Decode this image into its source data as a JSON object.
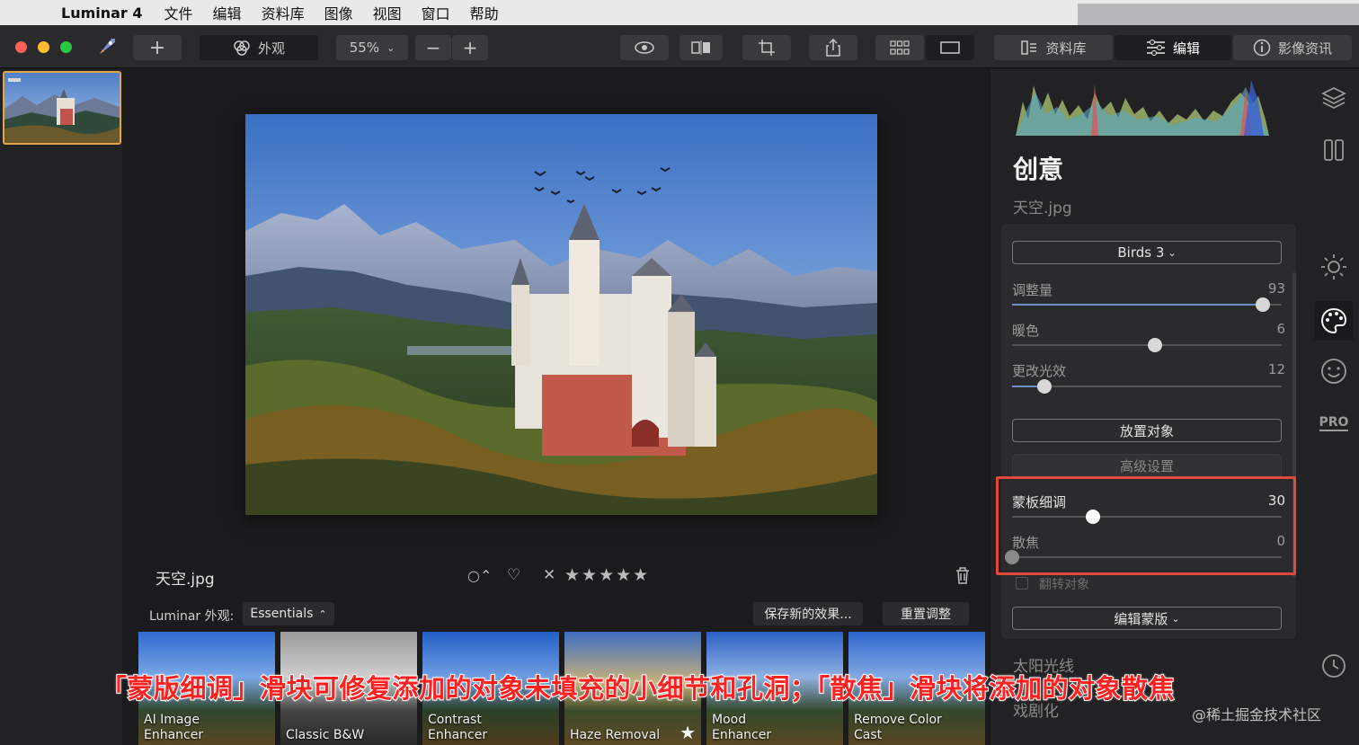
{
  "menubar": {
    "app_name": "Luminar 4",
    "items": [
      "文件",
      "编辑",
      "资料库",
      "图像",
      "视图",
      "窗口",
      "帮助"
    ]
  },
  "toolbar": {
    "looks_label": "外观",
    "zoom_value": "55%",
    "library_tab": "资料库",
    "edit_tab": "编辑",
    "info_tab": "影像资讯"
  },
  "main": {
    "filename": "天空.jpg",
    "looks": {
      "label": "Luminar 外观:",
      "collection": "Essentials",
      "save_button": "保存新的效果...",
      "reset_button": "重置调整"
    },
    "presets": [
      {
        "line1": "AI Image",
        "line2": "Enhancer"
      },
      {
        "line1": "",
        "line2": "Classic B&W"
      },
      {
        "line1": "Contrast",
        "line2": "Enhancer"
      },
      {
        "line1": "",
        "line2": "Haze Removal"
      },
      {
        "line1": "Mood",
        "line2": "Enhancer"
      },
      {
        "line1": "Remove Color",
        "line2": "Cast"
      }
    ]
  },
  "panel": {
    "section_title": "创意",
    "filename": "天空.jpg",
    "sky_select": "Birds 3",
    "sliders": {
      "amount": {
        "label": "调整量",
        "value": "93",
        "fraction": 0.93
      },
      "warmth": {
        "label": "暖色",
        "value": "6",
        "fraction": 0.53
      },
      "relight": {
        "label": "更改光效",
        "value": "12",
        "fraction": 0.12
      },
      "mask_refine": {
        "label": "蒙板细调",
        "value": "30",
        "fraction": 0.3
      },
      "defocus": {
        "label": "散焦",
        "value": "0",
        "fraction": 0.0
      }
    },
    "place_object_button": "放置对象",
    "advanced_button": "高级设置",
    "flip_object": "翻转对象",
    "edit_mask_button": "编辑蒙版",
    "next_section": "太阳光线",
    "next_section_2": "戏剧化"
  },
  "overlay_caption": "「蒙版细调」滑块可修复添加的对象未填充的小细节和孔洞；「散焦」滑块将添加的对象散焦",
  "watermark": "@稀土掘金技术社区",
  "colors": {
    "accent_orange": "#e3a646",
    "highlight_red": "#e04a3d",
    "slider_blue": "#6d8fc8"
  }
}
